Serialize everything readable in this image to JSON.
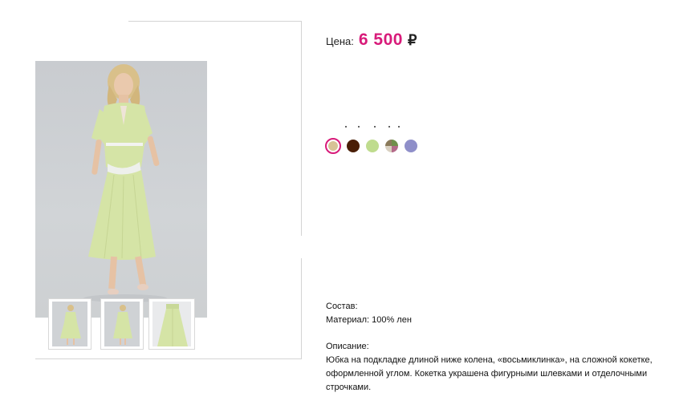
{
  "price": {
    "label": "Цена:",
    "value": "6 500",
    "currency": "₽",
    "accent_color": "#d81b7a"
  },
  "colors": {
    "options": [
      {
        "name": "beige",
        "hex": "#d7c296",
        "selected": true
      },
      {
        "name": "dark-brown",
        "hex": "#4a1e06",
        "selected": false
      },
      {
        "name": "light-green",
        "hex": "#bfdc8e",
        "selected": false
      },
      {
        "name": "floral-print",
        "hex": "#8a7a5a",
        "selected": false
      },
      {
        "name": "lavender",
        "hex": "#8f8fc9",
        "selected": false
      }
    ]
  },
  "composition": {
    "heading": "Состав:",
    "material": "Материал: 100% лен"
  },
  "description": {
    "heading": "Описание:",
    "text": "Юбка на подкладке длиной ниже колена, «восьмиклинка», на сложной  кокетке,\nоформленной углом. Кокетка украшена фигурными шлевками и отделочными\nстрочками."
  },
  "product_image": {
    "garment_color": "#d5e4a6",
    "background_color": "#cdd0d3"
  }
}
